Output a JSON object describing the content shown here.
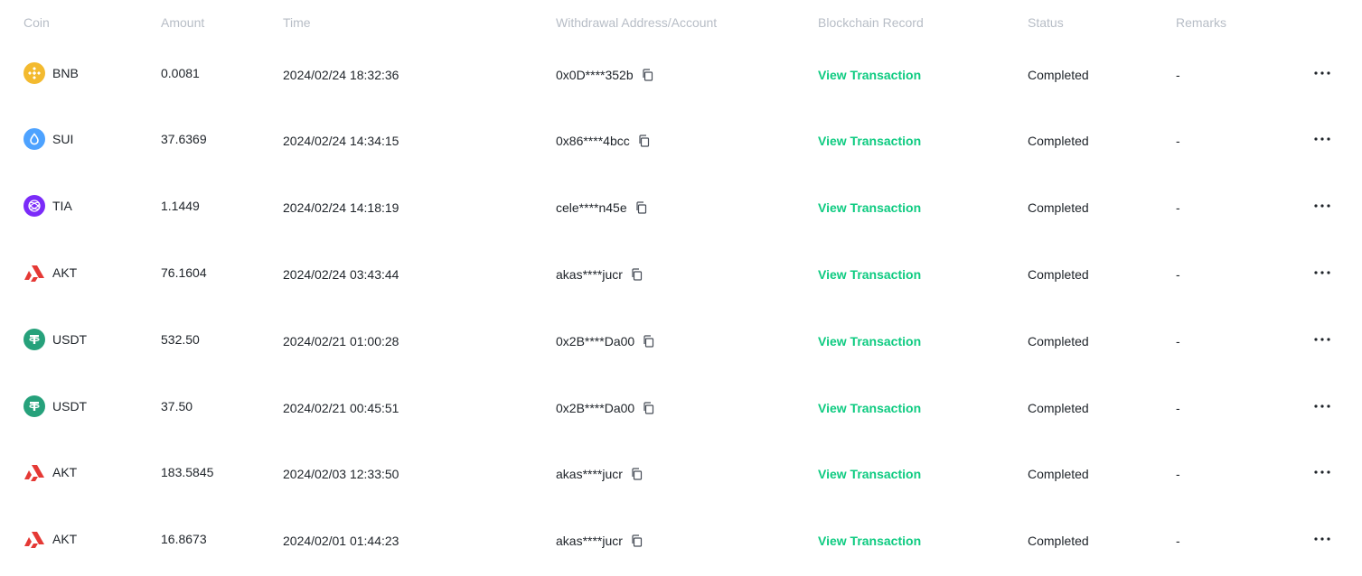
{
  "columns": {
    "coin": "Coin",
    "amount": "Amount",
    "time": "Time",
    "address": "Withdrawal Address/Account",
    "blockchain": "Blockchain Record",
    "status": "Status",
    "remarks": "Remarks"
  },
  "rows": [
    {
      "coin": "BNB",
      "icon": "bnb-icon",
      "amount": "0.0081",
      "time": "2024/02/24 18:32:36",
      "address": "0x0D****352b",
      "blockchain": "View Transaction",
      "status": "Completed",
      "remarks": "-"
    },
    {
      "coin": "SUI",
      "icon": "sui-icon",
      "amount": "37.6369",
      "time": "2024/02/24 14:34:15",
      "address": "0x86****4bcc",
      "blockchain": "View Transaction",
      "status": "Completed",
      "remarks": "-"
    },
    {
      "coin": "TIA",
      "icon": "tia-icon",
      "amount": "1.1449",
      "time": "2024/02/24 14:18:19",
      "address": "cele****n45e",
      "blockchain": "View Transaction",
      "status": "Completed",
      "remarks": "-"
    },
    {
      "coin": "AKT",
      "icon": "akt-icon",
      "amount": "76.1604",
      "time": "2024/02/24 03:43:44",
      "address": "akas****jucr",
      "blockchain": "View Transaction",
      "status": "Completed",
      "remarks": "-"
    },
    {
      "coin": "USDT",
      "icon": "usdt-icon",
      "amount": "532.50",
      "time": "2024/02/21 01:00:28",
      "address": "0x2B****Da00",
      "blockchain": "View Transaction",
      "status": "Completed",
      "remarks": "-"
    },
    {
      "coin": "USDT",
      "icon": "usdt-icon",
      "amount": "37.50",
      "time": "2024/02/21 00:45:51",
      "address": "0x2B****Da00",
      "blockchain": "View Transaction",
      "status": "Completed",
      "remarks": "-"
    },
    {
      "coin": "AKT",
      "icon": "akt-icon",
      "amount": "183.5845",
      "time": "2024/02/03 12:33:50",
      "address": "akas****jucr",
      "blockchain": "View Transaction",
      "status": "Completed",
      "remarks": "-"
    },
    {
      "coin": "AKT",
      "icon": "akt-icon",
      "amount": "16.8673",
      "time": "2024/02/01 01:44:23",
      "address": "akas****jucr",
      "blockchain": "View Transaction",
      "status": "Completed",
      "remarks": "-"
    }
  ],
  "icons": {
    "copy": "copy-icon",
    "more": "more-horizontal-icon"
  },
  "colors": {
    "link": "#0ecb81",
    "header_text": "#b7bdc6",
    "body_text": "#1e2329",
    "bnb": "#f3ba2f",
    "sui": "#4da2ff",
    "tia": "#7b2bf9",
    "usdt": "#26a17b",
    "akt": "#e53935"
  }
}
